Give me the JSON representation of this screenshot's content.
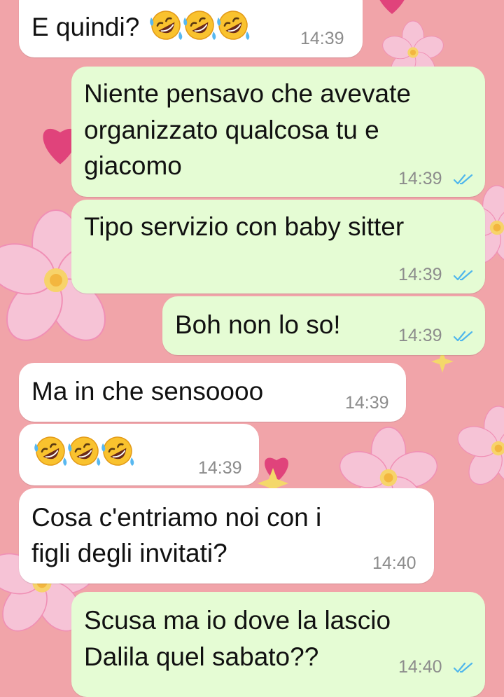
{
  "conversation": {
    "messages": [
      {
        "direction": "incoming",
        "text": "E quindi?",
        "emoji": [
          "rofl-emoji",
          "rofl-emoji",
          "rofl-emoji"
        ],
        "time": "14:39"
      },
      {
        "direction": "outgoing",
        "lines": [
          "Niente pensavo che avevate",
          "organizzato qualcosa tu e",
          "giacomo"
        ],
        "time": "14:39",
        "status": "read"
      },
      {
        "direction": "outgoing",
        "text": "Tipo servizio con baby sitter",
        "time": "14:39",
        "status": "read"
      },
      {
        "direction": "outgoing",
        "text": "Boh non lo so!",
        "time": "14:39",
        "status": "read"
      },
      {
        "direction": "incoming",
        "text": "Ma in che sensoooo",
        "time": "14:39"
      },
      {
        "direction": "incoming",
        "emoji": [
          "rofl-emoji",
          "rofl-emoji",
          "rofl-emoji"
        ],
        "time": "14:39"
      },
      {
        "direction": "incoming",
        "lines": [
          "Cosa c'entriamo noi con i",
          "figli degli invitati?"
        ],
        "time": "14:40"
      },
      {
        "direction": "outgoing",
        "lines": [
          "Scusa ma io dove la lascio",
          "Dalila quel sabato??"
        ],
        "time": "14:40",
        "status": "read"
      }
    ]
  },
  "colors": {
    "wallpaper": "#f1a4a9",
    "incoming_bubble": "#ffffff",
    "outgoing_bubble": "#e5fcd4",
    "timestamp": "#8c8c8c",
    "read_ticks": "#4fb6ec"
  },
  "wallpaper_icons": [
    "cherry-blossom-icon",
    "heart-icon",
    "sparkle-icon"
  ]
}
